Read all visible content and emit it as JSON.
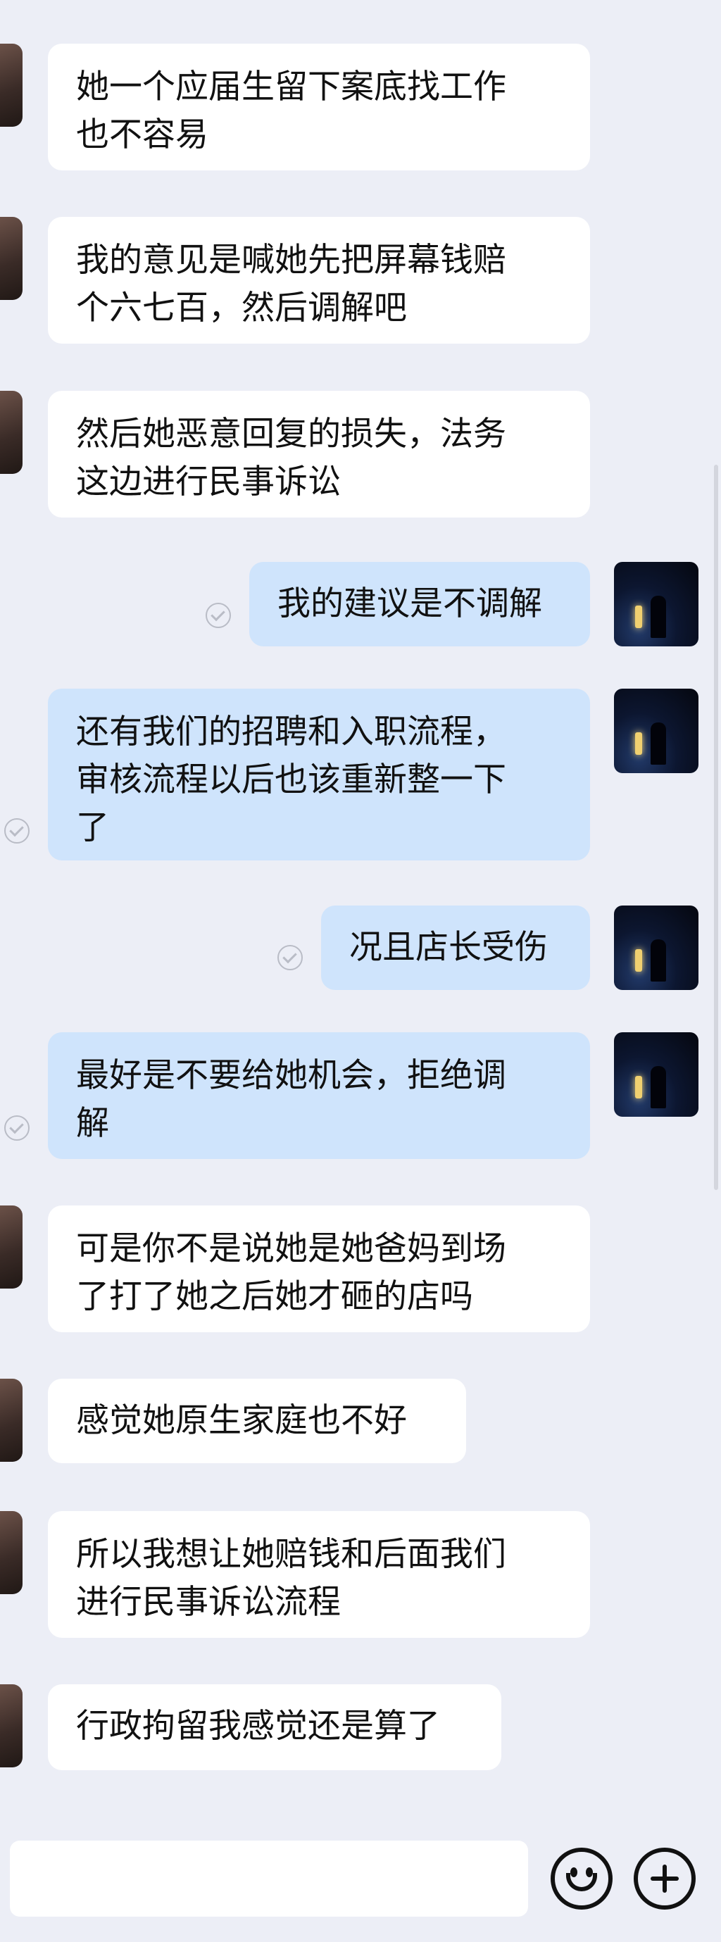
{
  "messages": [
    {
      "side": "in",
      "text": "她一个应届生留下案底找工作\n也不容易"
    },
    {
      "side": "in",
      "text": "我的意见是喊她先把屏幕钱赔\n个六七百，然后调解吧"
    },
    {
      "side": "in",
      "text": "然后她恶意回复的损失，法务\n这边进行民事诉讼"
    },
    {
      "side": "out",
      "text": "我的建议是不调解",
      "read": true
    },
    {
      "side": "out",
      "text": "还有我们的招聘和入职流程，\n审核流程以后也该重新整一下\n了",
      "read": true
    },
    {
      "side": "out",
      "text": "况且店长受伤",
      "read": true
    },
    {
      "side": "out",
      "text": "最好是不要给她机会，拒绝调\n解",
      "read": true
    },
    {
      "side": "in",
      "text": "可是你不是说她是她爸妈到场\n了打了她之后她才砸的店吗"
    },
    {
      "side": "in",
      "text": "感觉她原生家庭也不好"
    },
    {
      "side": "in",
      "text": "所以我想让她赔钱和后面我们\n进行民事诉讼流程"
    },
    {
      "side": "in",
      "text": "行政拘留我感觉还是算了"
    }
  ],
  "input": {
    "placeholder": ""
  },
  "icons": {
    "emoji": "emoji-icon",
    "add": "add-icon",
    "read_receipt": "check-circle-icon"
  }
}
